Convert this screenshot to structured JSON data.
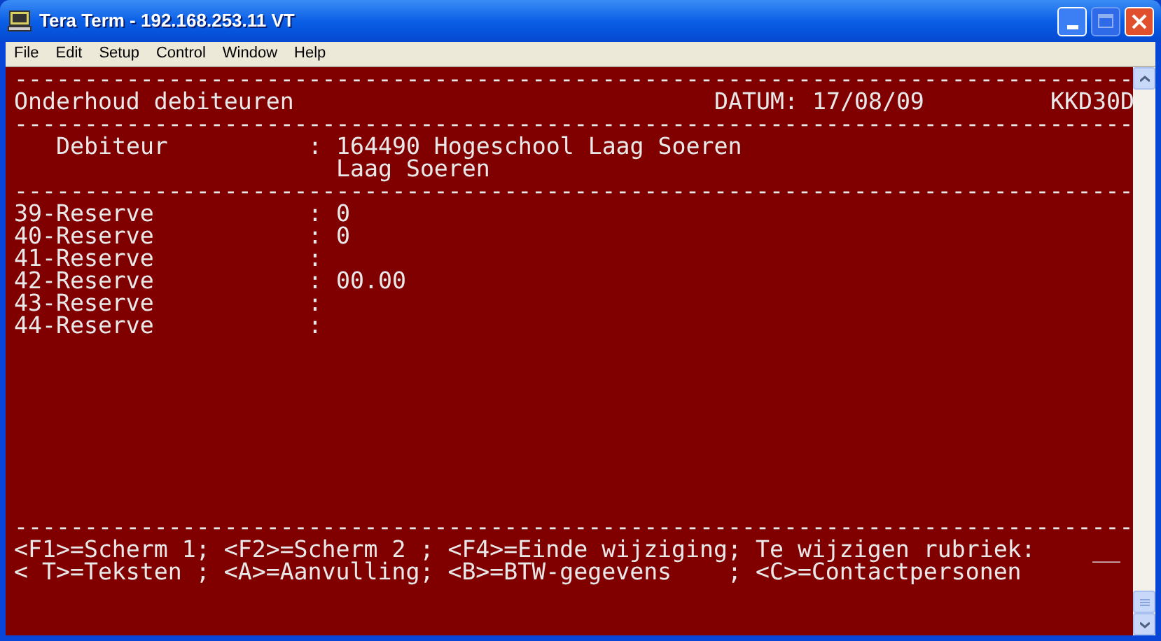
{
  "window": {
    "title": "Tera Term - 192.168.253.11 VT"
  },
  "menu": [
    {
      "label": "File"
    },
    {
      "label": "Edit"
    },
    {
      "label": "Setup"
    },
    {
      "label": "Control"
    },
    {
      "label": "Window"
    },
    {
      "label": "Help"
    }
  ],
  "screen": {
    "rule_top": "--------------------------------------------------------------------------------",
    "title": "Onderhoud debiteuren",
    "date_label": "DATUM:",
    "date": "17/08/09",
    "program": "KKD30D",
    "rule_header": "--------------------------------------------------------------------------------",
    "debtor": {
      "label": "Debiteur",
      "separator": ":",
      "value": "164490 Hogeschool Laag Soeren",
      "value_line_2": "Laag Soeren"
    },
    "rule_debtor": "--------------------------------------------------------------------------------",
    "fields": [
      {
        "label": "39-Reserve",
        "separator": ":",
        "value": "0"
      },
      {
        "label": "40-Reserve",
        "separator": ":",
        "value": "0"
      },
      {
        "label": "41-Reserve",
        "separator": ":"
      },
      {
        "label": "42-Reserve",
        "separator": ":",
        "value": "00.00"
      },
      {
        "label": "43-Reserve",
        "separator": ":"
      },
      {
        "label": "44-Reserve",
        "separator": ":"
      }
    ],
    "rule_footer": "--------------------------------------------------------------------------------",
    "footer": {
      "line_1": "<F1>=Scherm 1; <F2>=Scherm 2 ; <F4>=Einde wijziging; Te wijzigen rubriek:",
      "input": "__",
      "line_2": "< T>=Teksten ; <A>=Aanvulling; <B>=BTW-gegevens    ; <C>=Contactpersonen"
    }
  }
}
